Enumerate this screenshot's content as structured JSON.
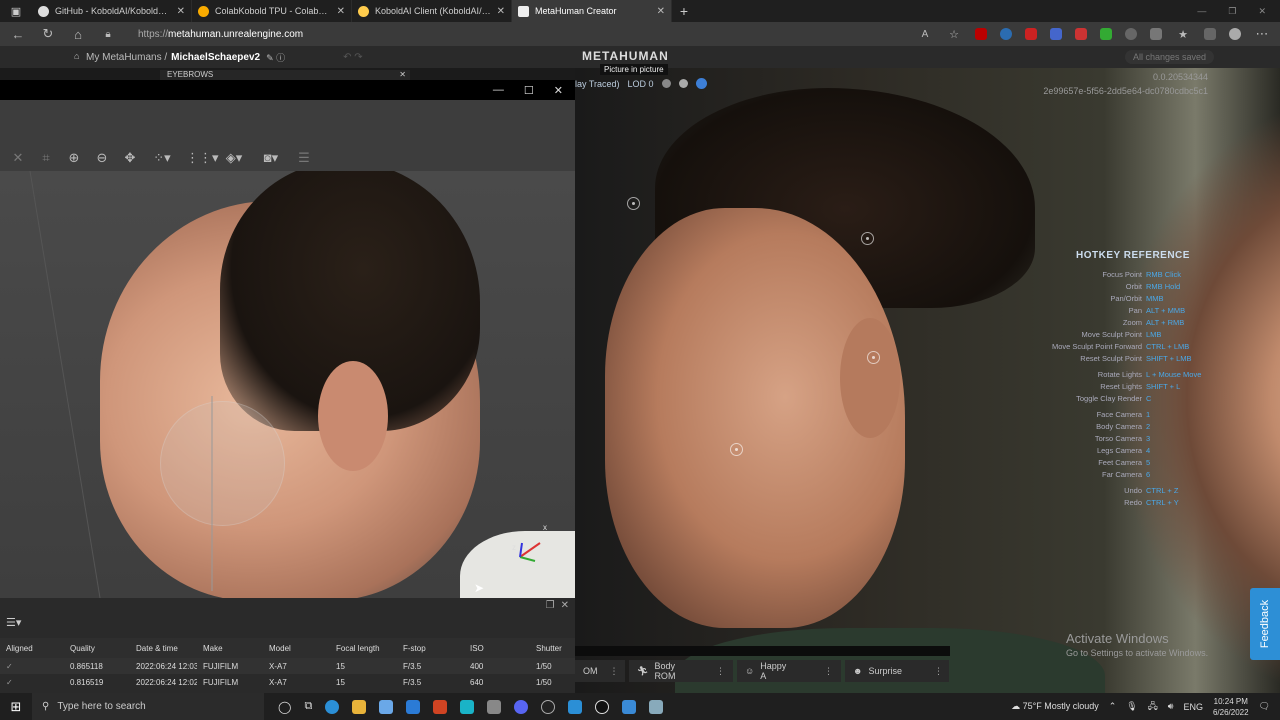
{
  "browser": {
    "tabs": [
      {
        "title": "GitHub - KoboldAI/KoboldAI-Cli",
        "active": false,
        "icon": "github-icon"
      },
      {
        "title": "ColabKobold TPU - Colaboratory",
        "active": false,
        "icon": "colab-icon"
      },
      {
        "title": "KoboldAI Client (KoboldAI/fairs",
        "active": false,
        "icon": "hf-icon"
      },
      {
        "title": "MetaHuman Creator",
        "active": true,
        "icon": "metahuman-icon"
      }
    ],
    "url_prefix": "https://",
    "url_host": "metahuman.unrealengine.com"
  },
  "appbar": {
    "breadcrumb_root": "My MetaHumans /",
    "breadcrumb_current": "MichaelSchaepev2",
    "logo": "METAHUMAN",
    "saved_status": "All changes saved",
    "pip_label": "Picture in picture"
  },
  "viewport": {
    "render_mode": "lay Traced)",
    "lod": "LOD 0",
    "build_line1": "0.0.20534344",
    "build_line2": "2e99657e-5f56-2dd5e64-dc0780cdbc5c1"
  },
  "hotkeys": {
    "title": "HOTKEY REFERENCE",
    "groups": [
      [
        {
          "k": "Focus Point",
          "v": "RMB Click"
        },
        {
          "k": "Orbit",
          "v": "RMB Hold"
        },
        {
          "k": "Pan/Orbit",
          "v": "MMB"
        },
        {
          "k": "Pan",
          "v": "ALT + MMB"
        },
        {
          "k": "Zoom",
          "v": "ALT + RMB"
        },
        {
          "k": "Move Sculpt Point",
          "v": "LMB"
        },
        {
          "k": "Move Sculpt Point Forward",
          "v": "CTRL + LMB"
        },
        {
          "k": "Reset Sculpt Point",
          "v": "SHIFT + LMB"
        }
      ],
      [
        {
          "k": "Rotate Lights",
          "v": "L + Mouse Move"
        },
        {
          "k": "Reset Lights",
          "v": "SHIFT + L"
        },
        {
          "k": "Toggle Clay Render",
          "v": "C"
        }
      ],
      [
        {
          "k": "Face Camera",
          "v": "1"
        },
        {
          "k": "Body Camera",
          "v": "2"
        },
        {
          "k": "Torso Camera",
          "v": "3"
        },
        {
          "k": "Legs Camera",
          "v": "4"
        },
        {
          "k": "Feet Camera",
          "v": "5"
        },
        {
          "k": "Far Camera",
          "v": "6"
        }
      ],
      [
        {
          "k": "Undo",
          "v": "CTRL + Z"
        },
        {
          "k": "Redo",
          "v": "CTRL + Y"
        }
      ]
    ]
  },
  "activate": {
    "line1": "Activate Windows",
    "line2": "Go to Settings to activate Windows."
  },
  "feedback_label": "Feedback",
  "poses": [
    {
      "label": "OM",
      "icon": ""
    },
    {
      "label": "Body ROM",
      "icon": "run-icon"
    },
    {
      "label": "Happy A",
      "icon": "smile-icon"
    },
    {
      "label": "Surprise",
      "icon": "face-icon"
    }
  ],
  "left_window": {
    "panel_tab": "EYEBROWS",
    "axis_x": "x",
    "axis_z": "z"
  },
  "table": {
    "headers": [
      "Aligned",
      "Quality",
      "Date & time",
      "Make",
      "Model",
      "Focal length",
      "F-stop",
      "ISO",
      "Shutter"
    ],
    "rows": [
      [
        "✓",
        "0.865118",
        "2022:06:24 12:03...",
        "FUJIFILM",
        "X-A7",
        "15",
        "F/3.5",
        "400",
        "1/50"
      ],
      [
        "✓",
        "0.816519",
        "2022:06:24 12:02...",
        "FUJIFILM",
        "X-A7",
        "15",
        "F/3.5",
        "640",
        "1/50"
      ]
    ]
  },
  "taskbar": {
    "search_placeholder": "Type here to search",
    "weather": "75°F  Mostly cloudy",
    "lang": "ENG",
    "time": "10:24 PM",
    "date": "6/26/2022"
  }
}
